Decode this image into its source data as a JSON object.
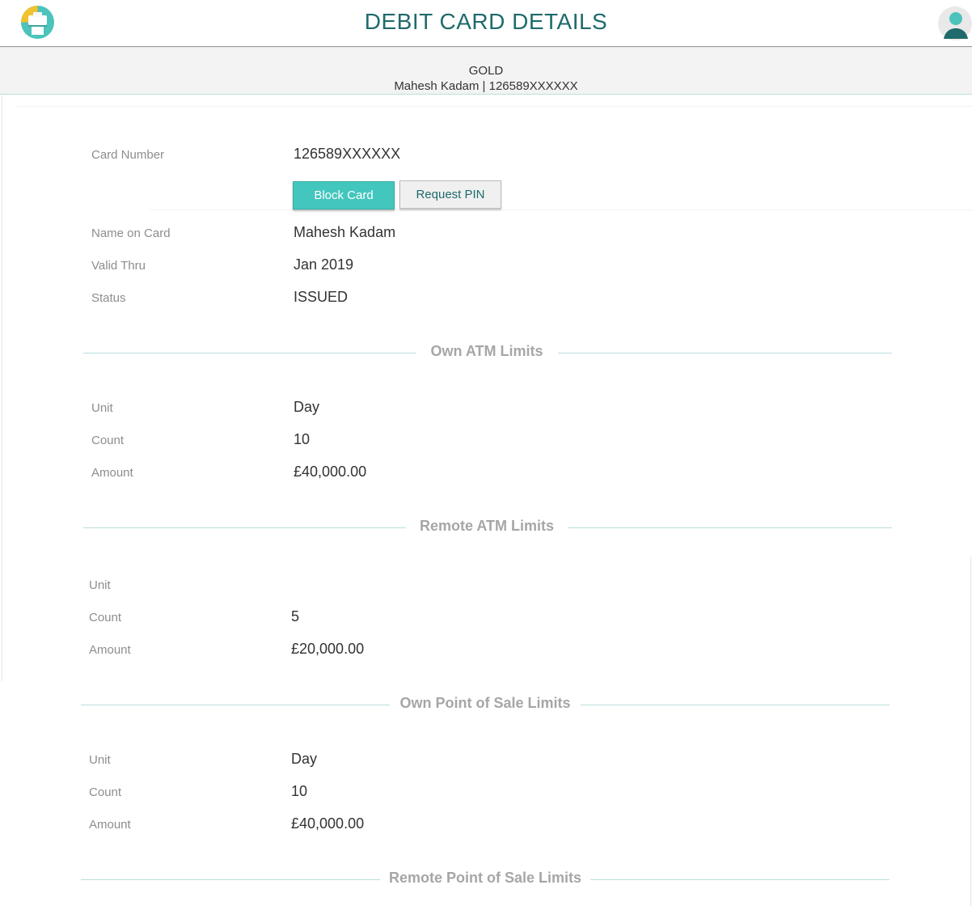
{
  "header": {
    "title": "DEBIT CARD DETAILS",
    "logo_icon": "printer-logo-icon",
    "avatar_icon": "user-avatar-icon"
  },
  "card_summary": {
    "type": "GOLD",
    "holder_line": "Mahesh Kadam | 126589XXXXXX"
  },
  "card_details": {
    "card_number_label": "Card Number",
    "card_number": "126589XXXXXX",
    "block_card_label": "Block Card",
    "request_pin_label": "Request PIN",
    "name_label": "Name on Card",
    "name": "Mahesh Kadam",
    "valid_thru_label": "Valid Thru",
    "valid_thru": "Jan 2019",
    "status_label": "Status",
    "status": "ISSUED"
  },
  "sections": {
    "own_atm": {
      "title": "Own ATM Limits",
      "unit_label": "Unit",
      "unit": "Day",
      "count_label": "Count",
      "count": "10",
      "amount_label": "Amount",
      "amount": "£40,000.00"
    },
    "remote_atm": {
      "title": "Remote ATM Limits",
      "unit_label": "Unit",
      "unit": "",
      "count_label": "Count",
      "count": "5",
      "amount_label": "Amount",
      "amount": "£20,000.00"
    },
    "own_pos": {
      "title": "Own Point of Sale Limits",
      "unit_label": "Unit",
      "unit": "Day",
      "count_label": "Count",
      "count": "10",
      "amount_label": "Amount",
      "amount": "£40,000.00"
    },
    "remote_pos": {
      "title": "Remote Point of Sale Limits"
    }
  },
  "colors": {
    "brand_teal": "#1f6b6b",
    "accent": "#43c6bd",
    "divider": "#b9e0dc"
  }
}
